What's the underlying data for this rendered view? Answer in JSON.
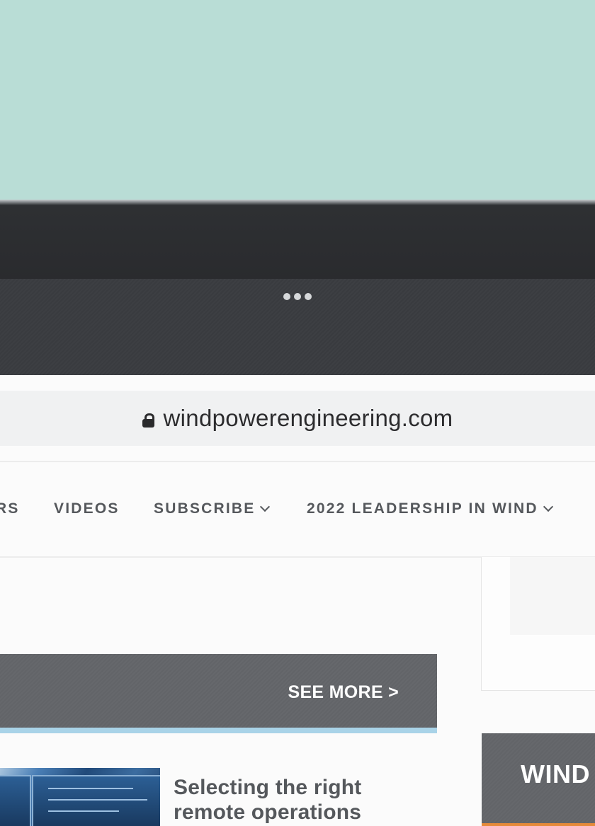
{
  "device": {
    "menu_dots": "•••"
  },
  "browser": {
    "url": "windpowerengineering.com",
    "lock_icon": "lock-icon"
  },
  "nav": {
    "items": [
      {
        "label": "RS",
        "has_dropdown": false
      },
      {
        "label": "VIDEOS",
        "has_dropdown": false
      },
      {
        "label": "SUBSCRIBE",
        "has_dropdown": true
      },
      {
        "label": "2022 LEADERSHIP IN WIND",
        "has_dropdown": true
      }
    ]
  },
  "section": {
    "see_more": "SEE MORE >",
    "accent_color": "#a9d3e8"
  },
  "article": {
    "title_line1": "Selecting the right",
    "title_line2": "remote operations"
  },
  "sidebar": {
    "card_title": "WIND",
    "stripe_color": "#e58a3a"
  }
}
